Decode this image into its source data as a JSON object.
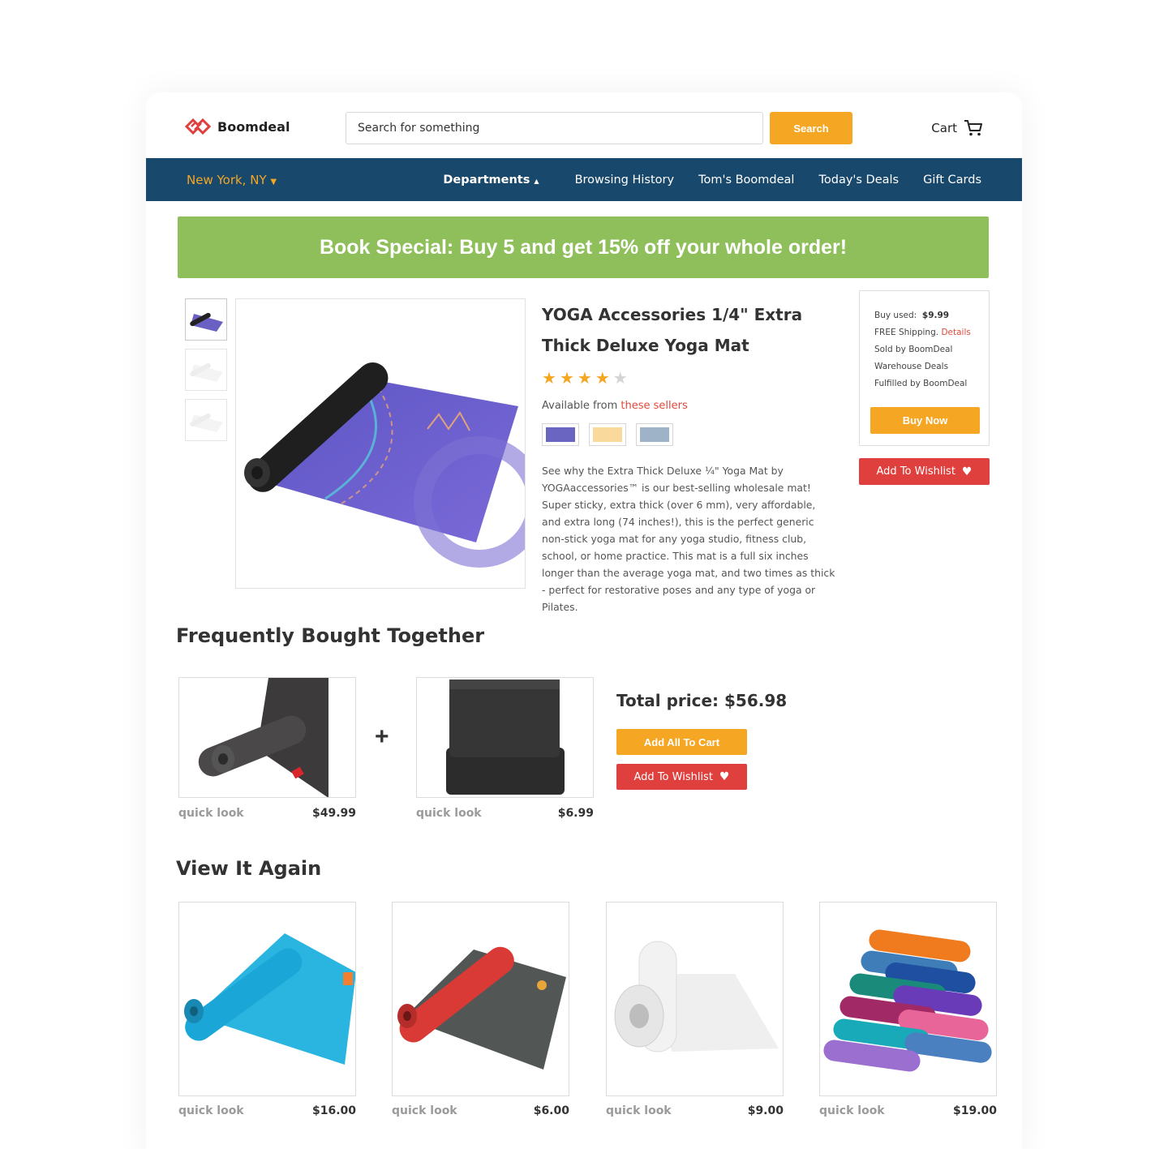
{
  "brand": {
    "name": "Boomdeal"
  },
  "search": {
    "placeholder": "Search for something",
    "button_label": "Search"
  },
  "cart": {
    "label": "Cart"
  },
  "nav": {
    "location": "New York, NY",
    "items": [
      {
        "label": "Departments",
        "has_dropdown": true
      },
      {
        "label": "Browsing History"
      },
      {
        "label": "Tom's Boomdeal"
      },
      {
        "label": "Today's Deals"
      },
      {
        "label": "Gift Cards"
      }
    ]
  },
  "promo": {
    "text": "Book Special: Buy 5 and get 15% off your whole order!"
  },
  "product": {
    "title": "YOGA Accessories 1/4\" Extra Thick Deluxe Yoga Mat",
    "rating": 4,
    "rating_max": 5,
    "available_prefix": "Available from",
    "available_link": "these sellers",
    "swatches": [
      "#6a65c0",
      "#f9d99c",
      "#9fb3c8"
    ],
    "description": "See why the Extra Thick Deluxe ¼\" Yoga Mat by YOGAaccessories™ is our best-selling wholesale mat! Super sticky, extra thick (over 6 mm), very affordable, and extra long (74 inches!), this is the perfect generic non-stick yoga mat for any yoga studio, fitness club, school, or home practice. This mat is a full six inches longer than the average yoga mat, and two times as thick - perfect for restorative poses and any type of yoga or Pilates."
  },
  "buybox": {
    "buy_used_label": "Buy used:",
    "buy_used_price": "$9.99",
    "shipping": "FREE Shipping.",
    "details_link": "Details",
    "sold_by": "Sold by BoomDeal",
    "warehouse": "Warehouse Deals",
    "fulfilled": "Fulfilled by BoomDeal",
    "buy_now": "Buy Now",
    "wishlist": "Add To Wishlist"
  },
  "frequently_bought": {
    "title": "Frequently Bought Together",
    "items": [
      {
        "quick_look": "quick look",
        "price": "$49.99",
        "icon": "dark-yoga-mat"
      },
      {
        "quick_look": "quick look",
        "price": "$6.99",
        "icon": "yoga-blocks"
      }
    ],
    "total": "Total price: $56.98",
    "add_all": "Add All To Cart",
    "wishlist": "Add To Wishlist"
  },
  "view_again": {
    "title": "View It Again",
    "items": [
      {
        "quick_look": "quick look",
        "price": "$16.00",
        "icon": "blue-yoga-mat"
      },
      {
        "quick_look": "quick look",
        "price": "$6.00",
        "icon": "red-grey-yoga-mat"
      },
      {
        "quick_look": "quick look",
        "price": "$9.00",
        "icon": "white-yoga-mat"
      },
      {
        "quick_look": "quick look",
        "price": "$19.00",
        "icon": "stacked-yoga-mats"
      }
    ]
  },
  "colors": {
    "accent": "#f5a623",
    "nav": "#18486b",
    "promo": "#8fbf5a",
    "wishlist": "#e0403d",
    "link": "#e0493c"
  }
}
